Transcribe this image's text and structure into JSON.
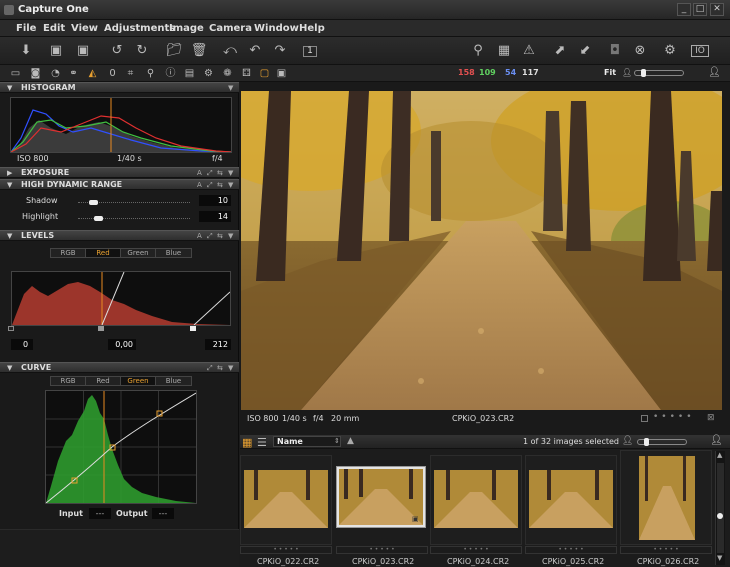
{
  "app": {
    "title": "Capture One"
  },
  "window_controls": {
    "minimize": "_",
    "maximize": "□",
    "close": "✕"
  },
  "menu": [
    "File",
    "Edit",
    "View",
    "Adjustments",
    "Image",
    "Camera",
    "Window",
    "Help"
  ],
  "toolbar": {
    "left_icons": [
      "import-icon",
      "capture-icon",
      "capture-settings-icon",
      "rotate-left-icon",
      "rotate-right-icon",
      "folder-icon",
      "trash-icon",
      "undo-all-icon",
      "undo-icon",
      "redo-icon",
      "single-view-icon"
    ],
    "right_icons": [
      "loupe-icon",
      "grid-icon",
      "warning-icon",
      "expand-icon",
      "shrink-icon",
      "camera-icon",
      "cancel-icon",
      "gear-icon",
      "io-icon"
    ]
  },
  "tool_tabs": {
    "icons": [
      "library-icon",
      "camera-tab-icon",
      "color-icon",
      "color-balance-icon",
      "exposure-tab-icon",
      "lens-icon",
      "crop-icon",
      "focus-icon",
      "metadata-icon",
      "output-icon",
      "settings-icon",
      "quick-icon",
      "batch-icon",
      "adjustments-icon"
    ],
    "rgb_readout": {
      "r": "158",
      "g": "109",
      "b": "54",
      "l": "117"
    },
    "fit_label": "Fit"
  },
  "histogram": {
    "title": "HISTOGRAM",
    "iso": "ISO 800",
    "shutter": "1/40 s",
    "aperture": "f/4"
  },
  "exposure": {
    "title": "EXPOSURE"
  },
  "hdr": {
    "title": "HIGH DYNAMIC RANGE",
    "shadow_label": "Shadow",
    "shadow_value": "10",
    "shadow_level": 0.1,
    "highlight_label": "Highlight",
    "highlight_value": "14",
    "highlight_level": 0.14
  },
  "levels": {
    "title": "LEVELS",
    "channels": [
      "RGB",
      "Red",
      "Green",
      "Blue"
    ],
    "active_channel": "Red",
    "low_value": "0",
    "mid_value": "0,00",
    "high_value": "212"
  },
  "curve": {
    "title": "CURVE",
    "channels": [
      "RGB",
      "Red",
      "Green",
      "Blue"
    ],
    "active_channel": "Green",
    "input_label": "Input",
    "input_value": "---",
    "output_label": "Output",
    "output_value": "---"
  },
  "viewer": {
    "iso": "ISO 800",
    "shutter": "1/40 s",
    "aperture": "f/4",
    "focal": "20 mm",
    "filename": "CPKiO_023.CR2"
  },
  "browser": {
    "sort_label": "Name",
    "count_text": "1 of 32 images selected",
    "thumbnails": [
      {
        "label": "CPKiO_022.CR2",
        "selected": false
      },
      {
        "label": "CPKiO_023.CR2",
        "selected": true
      },
      {
        "label": "CPKiO_024.CR2",
        "selected": false
      },
      {
        "label": "CPKiO_025.CR2",
        "selected": false
      },
      {
        "label": "CPKiO_026.CR2",
        "selected": false
      }
    ]
  }
}
